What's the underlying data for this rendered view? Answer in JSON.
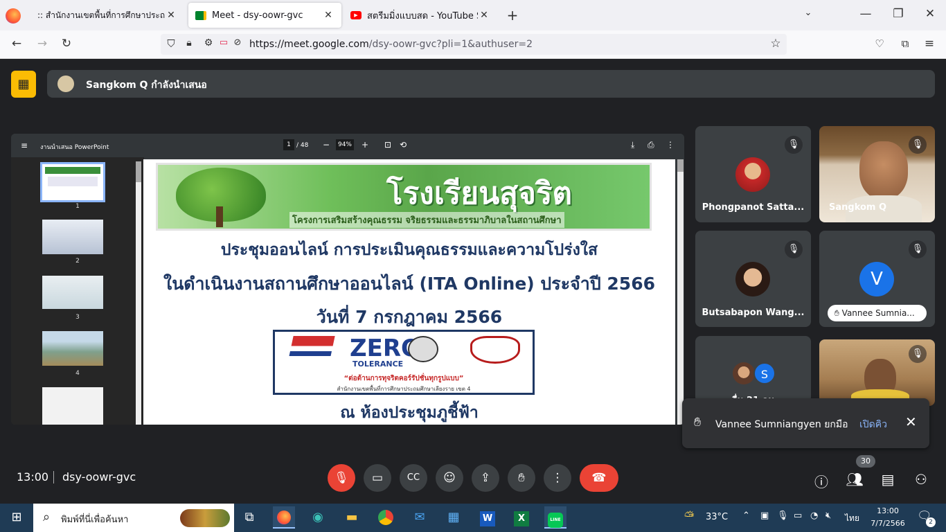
{
  "browser": {
    "tabs": [
      {
        "title": ":: สำนักงานเขตพื้นที่การศึกษาประถมศึกษ"
      },
      {
        "title": "Meet - dsy-oowr-gvc"
      },
      {
        "title": "สตรีมมิ่งแบบสด - YouTube Studio"
      }
    ],
    "url_host": "https://meet.google.com",
    "url_path": "/dsy-oowr-gvc?pli=1&authuser=2"
  },
  "meet": {
    "presenter_banner": "Sangkom Q กำลังนำเสนอ",
    "pdf": {
      "title": "งานนำเสนอ PowerPoint",
      "page": "1",
      "page_total": "/ 48",
      "zoom": "94%",
      "thumbnail_numbers": [
        "1",
        "2",
        "3",
        "4"
      ]
    },
    "slide": {
      "banner_title": "โรงเรียนสุจริต",
      "banner_subtitle": "โครงการเสริมสร้างคุณธรรม จริยธรรมและธรรมาภิบาลในสถานศึกษา",
      "line1": "ประชุมออนไลน์ การประเมินคุณธรรมและความโปร่งใส",
      "line2": "ในดำเนินงานสถานศึกษาออนไลน์ (ITA Online) ประจำปี 2566",
      "line3": "วันที่ 7 กรกฎาคม 2566",
      "logo_word": "ZERO",
      "logo_sub": "TOLERANCE",
      "logo_motto": "“ต่อต้านการทุจริตคอร์รัปชั่นทุกรูปแบบ”",
      "logo_office": "สำนักงานเขตพื้นที่การศึกษาประถมศึกษาเลียงราย เขต 4",
      "line4": "ณ ห้องประชุมภูชี้ฟ้า"
    },
    "participants": [
      {
        "name": "Phongpanot Satta..."
      },
      {
        "name": "Sangkom Q"
      },
      {
        "name": "Butsabapon Wang..."
      },
      {
        "name": "Vannee Sumnia...",
        "initial": "V"
      },
      {
        "name": "อื่น 21 คน",
        "initial": "S"
      },
      {
        "name": ""
      }
    ],
    "toast": {
      "text": "Vannee Sumniangyen ยกมือ",
      "action": "เปิดคิว"
    },
    "time": "13:00",
    "meeting_code": "dsy-oowr-gvc",
    "people_count": "30",
    "colors": {
      "end_call": "#ea4335",
      "muted": "#ea4335",
      "accent": "#8ab4f8",
      "present_badge": "#fbbc04"
    }
  },
  "taskbar": {
    "search_placeholder": "พิมพ์ที่นี่เพื่อค้นหา",
    "weather": "33°C",
    "lang": "ไทย",
    "clock_time": "13:00",
    "clock_date": "7/7/2566",
    "notifications": "2"
  }
}
